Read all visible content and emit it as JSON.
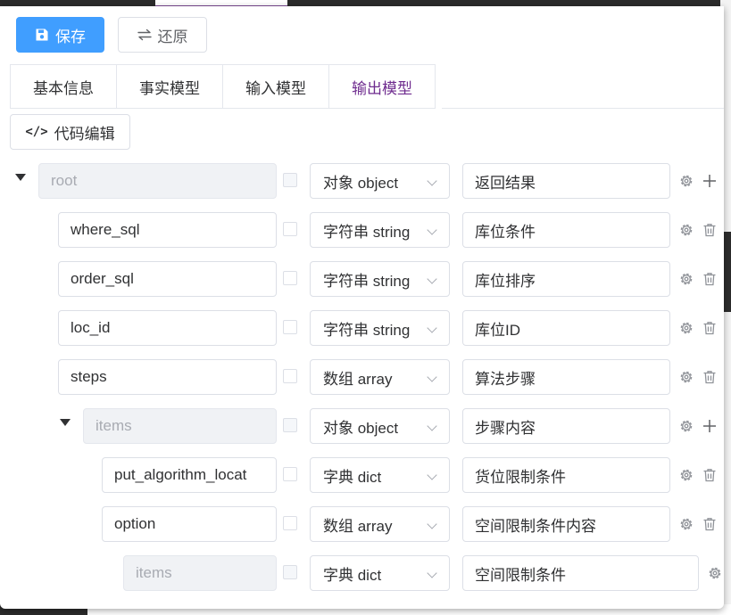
{
  "toolbar": {
    "save_label": "保存",
    "restore_label": "还原"
  },
  "tabs": [
    {
      "label": "基本信息",
      "active": false
    },
    {
      "label": "事实模型",
      "active": false
    },
    {
      "label": "输入模型",
      "active": false
    },
    {
      "label": "输出模型",
      "active": true
    }
  ],
  "code_edit_label": "代码编辑",
  "rows": [
    {
      "name": "root",
      "name_disabled": true,
      "type": "对象 object",
      "desc": "返回结果",
      "action": "add"
    },
    {
      "name": "where_sql",
      "name_disabled": false,
      "type": "字符串 string",
      "desc": "库位条件",
      "action": "delete"
    },
    {
      "name": "order_sql",
      "name_disabled": false,
      "type": "字符串 string",
      "desc": "库位排序",
      "action": "delete"
    },
    {
      "name": "loc_id",
      "name_disabled": false,
      "type": "字符串 string",
      "desc": "库位ID",
      "action": "delete"
    },
    {
      "name": "steps",
      "name_disabled": false,
      "type": "数组 array",
      "desc": "算法步骤",
      "action": "delete"
    },
    {
      "name": "items",
      "name_disabled": true,
      "type": "对象 object",
      "desc": "步骤内容",
      "action": "add"
    },
    {
      "name": "put_algorithm_locat",
      "name_disabled": false,
      "type": "字典 dict",
      "desc": "货位限制条件",
      "action": "delete"
    },
    {
      "name": "option",
      "name_disabled": false,
      "type": "数组 array",
      "desc": "空间限制条件内容",
      "action": "delete"
    },
    {
      "name": "items",
      "name_disabled": true,
      "type": "字典 dict",
      "desc": "空间限制条件",
      "action": "none"
    }
  ]
}
